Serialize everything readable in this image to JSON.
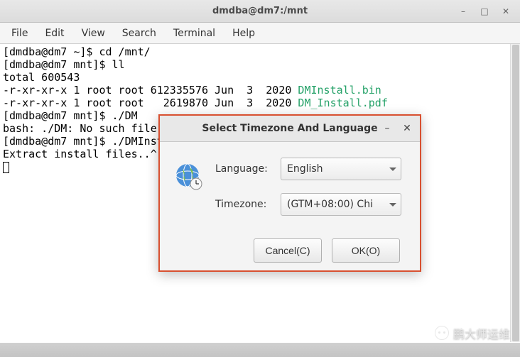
{
  "window": {
    "title": "dmdba@dm7:/mnt"
  },
  "menubar": [
    "File",
    "Edit",
    "View",
    "Search",
    "Terminal",
    "Help"
  ],
  "terminal": {
    "lines": [
      "[dmdba@dm7 ~]$ cd /mnt/",
      "[dmdba@dm7 mnt]$ ll",
      "total 600543",
      "-r-xr-xr-x 1 root root 612335576 Jun  3  2020 ",
      "-r-xr-xr-x 1 root root   2619870 Jun  3  2020 ",
      "[dmdba@dm7 mnt]$ ./DM",
      "bash: ./DM: No such file ",
      "[dmdba@dm7 mnt]$ ./DMInst",
      "Extract install files..^."
    ],
    "files": {
      "f1": "DMInstall.bin",
      "f2": "DM_Install.pdf"
    }
  },
  "dialog": {
    "title": "Select Timezone And Language",
    "language_label": "Language:",
    "language_value": "English",
    "timezone_label": "Timezone:",
    "timezone_value": "(GTM+08:00) Chi",
    "cancel": "Cancel(C)",
    "ok": "OK(O)"
  },
  "watermark": "鹏大师运维"
}
